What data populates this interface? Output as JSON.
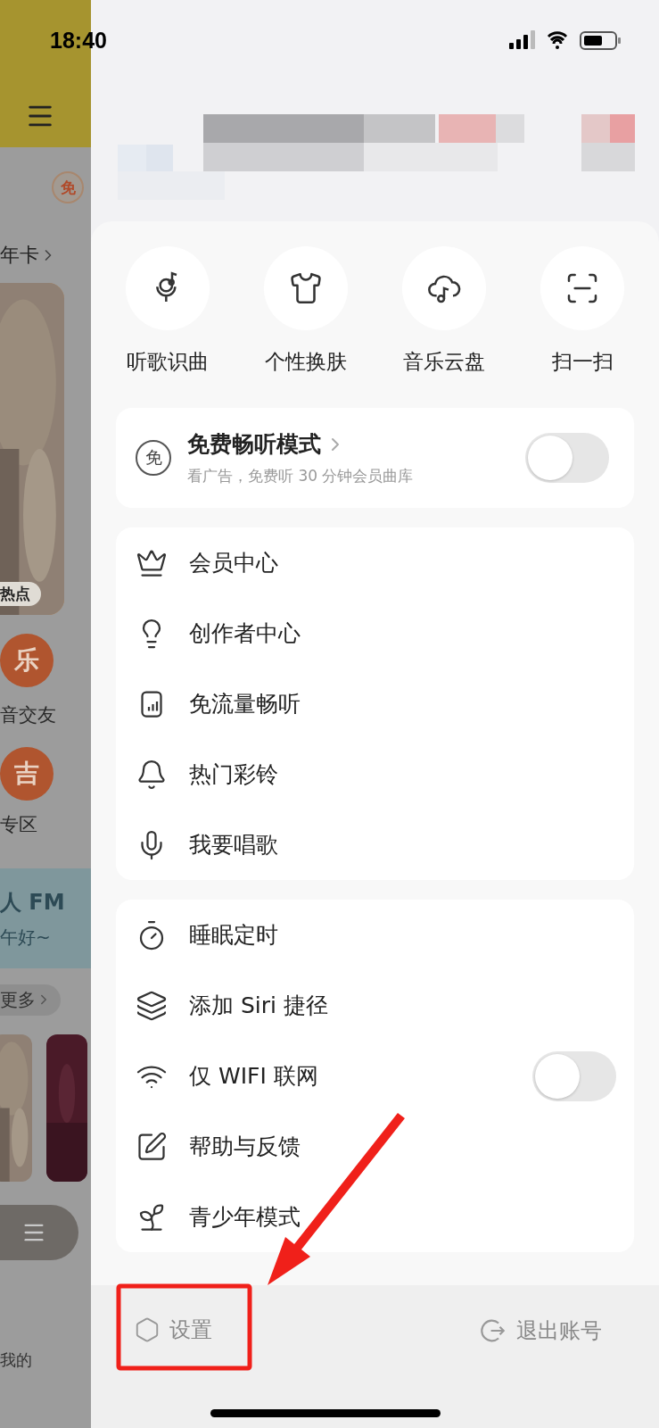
{
  "status_bar": {
    "time": "18:40"
  },
  "background_app": {
    "badge": "免",
    "vip_link": "年卡",
    "banner_tag": "热点",
    "shortcuts": [
      {
        "glyph": "乐",
        "label": "音交友"
      },
      {
        "glyph": "吉",
        "label": "专区"
      }
    ],
    "fm_title": "人 FM",
    "fm_subtitle": "午好~",
    "more": "更多",
    "tab": "我的"
  },
  "quick_actions": [
    {
      "label": "听歌识曲"
    },
    {
      "label": "个性换肤"
    },
    {
      "label": "音乐云盘"
    },
    {
      "label": "扫一扫"
    }
  ],
  "free_mode": {
    "badge": "免",
    "title": "免费畅听模式",
    "subtitle": "看广告，免费听 30 分钟会员曲库",
    "on": false
  },
  "menu_groups": [
    [
      {
        "label": "会员中心",
        "kind": "link"
      },
      {
        "label": "创作者中心",
        "kind": "link"
      },
      {
        "label": "免流量畅听",
        "kind": "link"
      },
      {
        "label": "热门彩铃",
        "kind": "link"
      },
      {
        "label": "我要唱歌",
        "kind": "link"
      }
    ],
    [
      {
        "label": "睡眠定时",
        "kind": "link"
      },
      {
        "label": "添加 Siri 捷径",
        "kind": "link"
      },
      {
        "label": "仅 WIFI 联网",
        "kind": "toggle",
        "on": false
      },
      {
        "label": "帮助与反馈",
        "kind": "link"
      },
      {
        "label": "青少年模式",
        "kind": "link"
      }
    ]
  ],
  "footer": {
    "settings": "设置",
    "logout": "退出账号"
  },
  "annotation": {
    "kind": "arrow_box"
  }
}
